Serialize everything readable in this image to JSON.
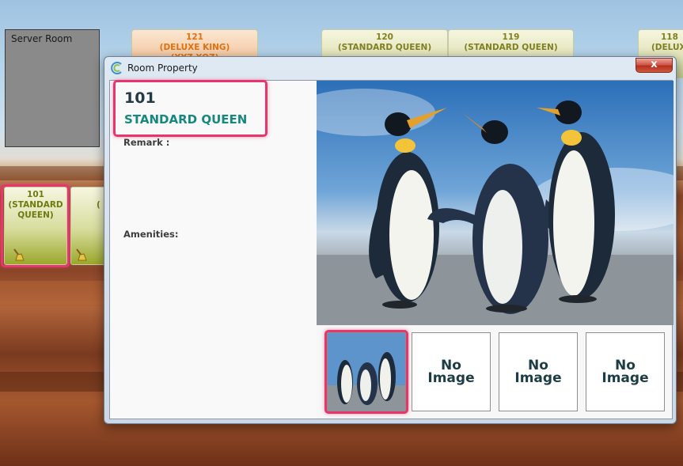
{
  "server_room": {
    "label": "Server Room"
  },
  "tiles": {
    "t121": {
      "number": "121",
      "type": "(DELUXE KING)",
      "peek": "(XYZ XOZ)"
    },
    "t120": {
      "number": "120",
      "type": "(STANDARD QUEEN)"
    },
    "t119": {
      "number": "119",
      "type": "(STANDARD QUEEN)"
    },
    "t118": {
      "number": "118",
      "type": "(DELUX"
    },
    "t101": {
      "line1": "101",
      "line2": "(STANDARD",
      "line3": "QUEEN)"
    },
    "t102": {
      "partial": "("
    }
  },
  "dialog": {
    "title": "Room Property",
    "close_label": "x",
    "room_number": "101",
    "room_type": "STANDARD QUEEN",
    "remark_label": "Remark :",
    "amenities_label": "Amenities:",
    "no_image_1": "No",
    "no_image_2": "Image"
  },
  "colors": {
    "highlight": "#e8366d",
    "room_type_text": "#16887f",
    "king_text": "#e2710f",
    "queen_text": "#808020"
  },
  "icons": [
    "broom-icon",
    "app-icon",
    "close-icon",
    "penguin-photo"
  ]
}
